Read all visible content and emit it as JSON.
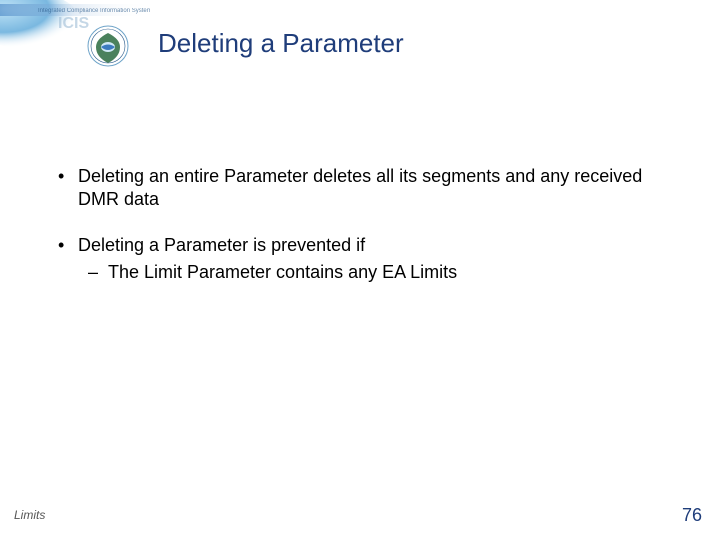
{
  "header": {
    "title": "Deleting a Parameter",
    "system_label": "Integrated Compliance Information System",
    "system_abbrev": "ICIS"
  },
  "bullets": [
    {
      "text": "Deleting an entire Parameter deletes all its segments and any received DMR data",
      "sub": []
    },
    {
      "text": "Deleting a Parameter is prevented if",
      "sub": [
        "The Limit Parameter contains any EA Limits"
      ]
    }
  ],
  "footer": {
    "left": "Limits",
    "page": "76"
  }
}
